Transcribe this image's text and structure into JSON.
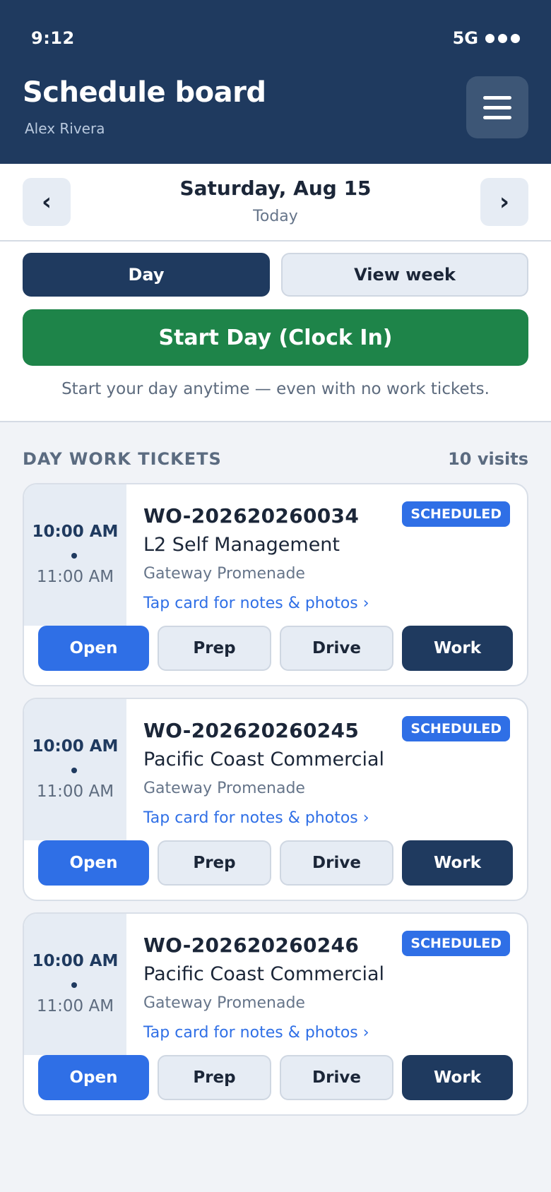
{
  "status_bar": {
    "time": "9:12",
    "network": "5G"
  },
  "header": {
    "title": "Schedule board",
    "user": "Alex Rivera",
    "menu_icon": "hamburger-icon"
  },
  "date_nav": {
    "prev": "‹",
    "next": "›",
    "date": "Saturday, Aug 15",
    "relative": "Today"
  },
  "view_toggle": {
    "day": "Day",
    "week": "View week",
    "selected": "Day"
  },
  "clock": {
    "label": "Start Day (Clock In)",
    "hint": "Start your day anytime — even with no work tickets."
  },
  "section": {
    "title": "DAY WORK TICKETS",
    "count": "10 visits"
  },
  "tickets": [
    {
      "start": "10:00 AM",
      "end": "11:00 AM",
      "id": "WO-202620260034",
      "status": "SCHEDULED",
      "client": "L2 Self Management",
      "site": "Gateway Promenade",
      "link": "Tap card for notes & photos ›",
      "actions": {
        "open": "Open",
        "prep": "Prep",
        "drive": "Drive",
        "work": "Work"
      }
    },
    {
      "start": "10:00 AM",
      "end": "11:00 AM",
      "id": "WO-202620260245",
      "status": "SCHEDULED",
      "client": "Pacific Coast Commercial",
      "site": "Gateway Promenade",
      "link": "Tap card for notes & photos ›",
      "actions": {
        "open": "Open",
        "prep": "Prep",
        "drive": "Drive",
        "work": "Work"
      }
    },
    {
      "start": "10:00 AM",
      "end": "11:00 AM",
      "id": "WO-202620260246",
      "status": "SCHEDULED",
      "client": "Pacific Coast Commercial",
      "site": "Gateway Promenade",
      "link": "Tap card for notes & photos ›",
      "actions": {
        "open": "Open",
        "prep": "Prep",
        "drive": "Drive",
        "work": "Work"
      }
    }
  ],
  "colors": {
    "header_bg": "#1f3a5f",
    "accent_blue": "#2f6fe6",
    "clock_green": "#1e8449",
    "page_bg": "#f1f3f7"
  }
}
